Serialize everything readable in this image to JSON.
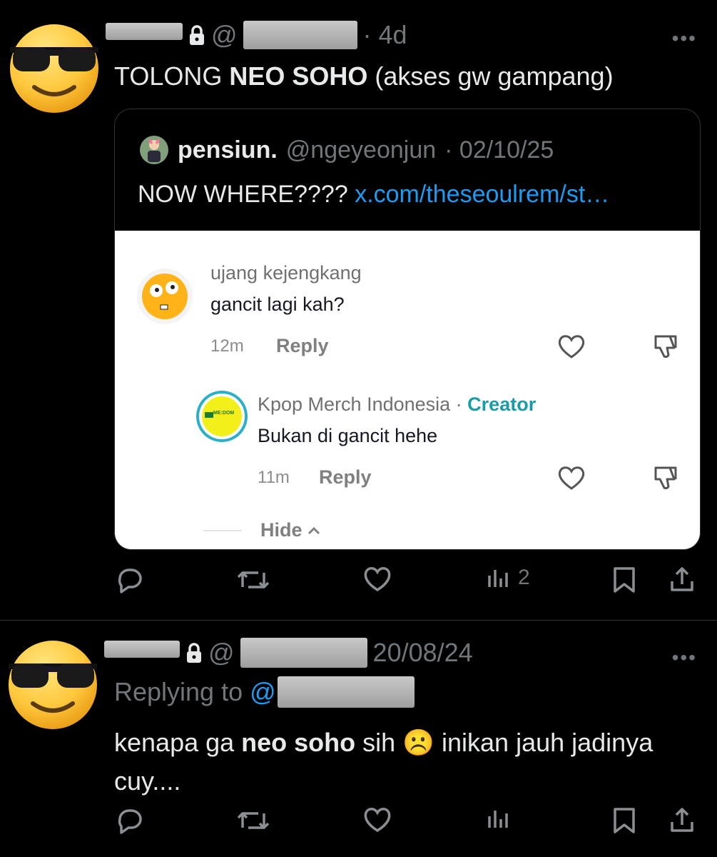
{
  "tweet1": {
    "time": "· 4d",
    "at": "@",
    "text_pre": "TOLONG ",
    "text_bold": "NEO SOHO",
    "text_post": " (akses gw gampang)",
    "more": "•••",
    "quote": {
      "name": "pensiun.",
      "handle": "@ngeyeonjun",
      "date": "· 02/10/25",
      "text": "NOW WHERE????",
      "link": "x.com/theseoulrem/st…",
      "comments": [
        {
          "name": "ujang kejengkang",
          "text": "gancit lagi kah?",
          "time": "12m",
          "reply": "Reply"
        },
        {
          "name": "Kpop Merch Indonesia",
          "sep": " · ",
          "badge": "Creator",
          "avatar_text": "ME:DOM",
          "text": "Bukan di gancit hehe",
          "time": "11m",
          "reply": "Reply"
        }
      ],
      "hide": "Hide"
    },
    "views": "2"
  },
  "tweet2": {
    "at": "@",
    "date": "20/08/24",
    "more": "•••",
    "replying_to": "Replying to",
    "replying_at": "@",
    "text_pre": "kenapa ga ",
    "text_bold": "neo soho",
    "text_mid": " sih ",
    "emoji": "☹️",
    "text_post": " inikan jauh jadinya",
    "text_line2": "cuy...."
  },
  "icons": [
    "reply-icon",
    "retweet-icon",
    "like-icon",
    "views-icon",
    "bookmark-icon",
    "share-icon"
  ],
  "colors": {
    "bg": "#000000",
    "link": "#1d9bf0",
    "muted": "#71767b",
    "creator": "#1a9ba8"
  }
}
